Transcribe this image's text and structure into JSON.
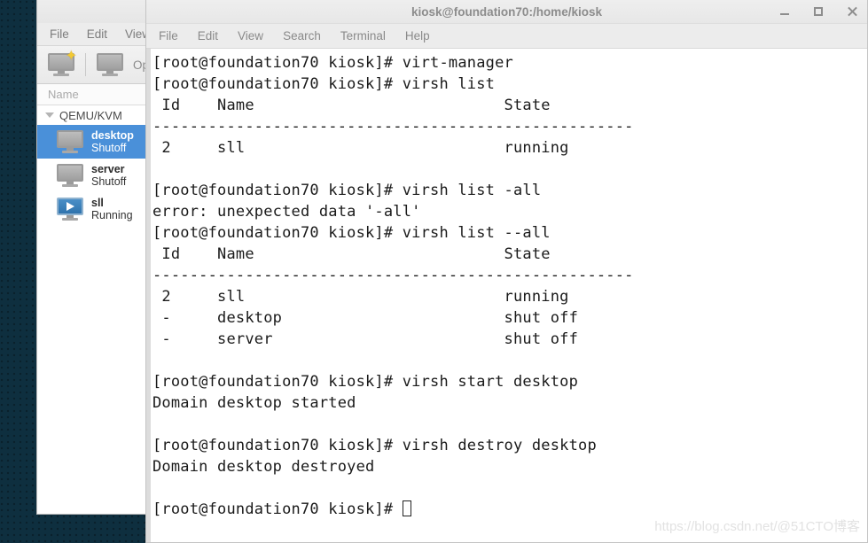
{
  "desktop": {
    "background_color": "#0e2f3f"
  },
  "vmm_window": {
    "menu": [
      {
        "label": "File"
      },
      {
        "label": "Edit"
      },
      {
        "label": "View"
      }
    ],
    "toolbar": {
      "new_vm_icon": "new-vm-monitor-icon",
      "open_icon": "monitor-icon",
      "open_label": "Ope"
    },
    "column_header": "Name",
    "connection": {
      "label": "QEMU/KVM",
      "expander_icon": "triangle-down-icon"
    },
    "vms": [
      {
        "name": "desktop",
        "state": "Shutoff",
        "icon": "monitor-icon",
        "selected": true
      },
      {
        "name": "server",
        "state": "Shutoff",
        "icon": "monitor-icon",
        "selected": false
      },
      {
        "name": "sll",
        "state": "Running",
        "icon": "monitor-play-icon",
        "selected": false
      }
    ],
    "selection_color": "#4a90d9"
  },
  "terminal_window": {
    "title": "kiosk@foundation70:/home/kiosk",
    "window_buttons": [
      {
        "name": "minimize",
        "icon": "minimize-icon"
      },
      {
        "name": "maximize",
        "icon": "maximize-icon"
      },
      {
        "name": "close",
        "icon": "close-icon"
      }
    ],
    "menu": [
      {
        "label": "File"
      },
      {
        "label": "Edit"
      },
      {
        "label": "View"
      },
      {
        "label": "Search"
      },
      {
        "label": "Terminal"
      },
      {
        "label": "Help"
      }
    ],
    "prompt": "[root@foundation70 kiosk]# ",
    "output": "[root@foundation70 kiosk]# virt-manager\n[root@foundation70 kiosk]# virsh list\n Id    Name                           State\n----------------------------------------------------\n 2     sll                            running\n\n[root@foundation70 kiosk]# virsh list -all\nerror: unexpected data '-all'\n[root@foundation70 kiosk]# virsh list --all\n Id    Name                           State\n----------------------------------------------------\n 2     sll                            running\n -     desktop                        shut off\n -     server                         shut off\n\n[root@foundation70 kiosk]# virsh start desktop\nDomain desktop started\n\n[root@foundation70 kiosk]# virsh destroy desktop\nDomain desktop destroyed\n\n",
    "cursor": "block-cursor"
  },
  "watermark": {
    "text": "https://blog.csdn.net/@51CTO博客"
  }
}
